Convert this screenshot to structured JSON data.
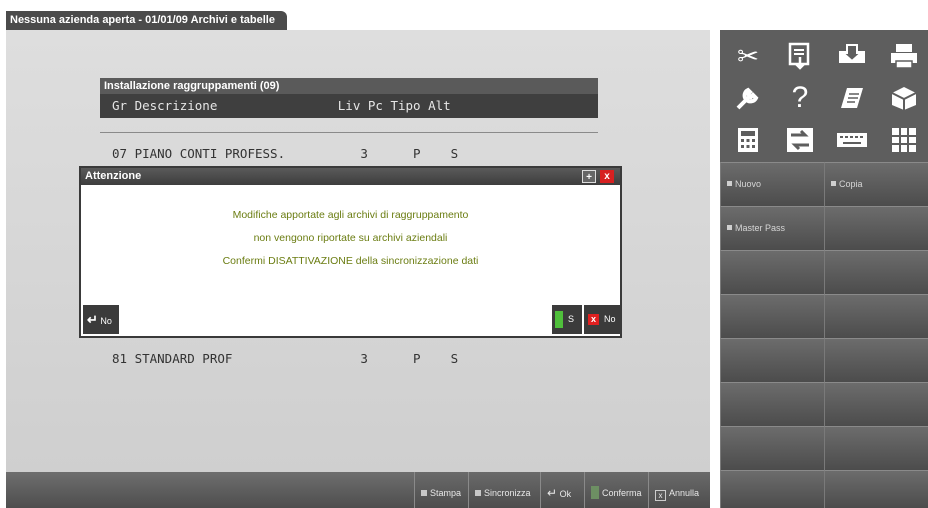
{
  "window": {
    "title": "Nessuna azienda aperta - 01/01/09  Archivi e tabelle"
  },
  "table": {
    "caption": "Installazione raggruppamenti (09)",
    "header": "Gr Descrizione                Liv Pc Tipo Alt",
    "rows": [
      "07 PIANO CONTI PROFESS.          3      P    S",
      "81 STANDARD PROF                 3      P    S"
    ]
  },
  "dialog": {
    "title": "Attenzione",
    "messages": [
      "Modifiche apportate agli archivi di raggruppamento",
      "non vengono riportate su archivi aziendali",
      "Confermi DISATTIVAZIONE della sincronizzazione dati"
    ],
    "left_button": "No",
    "yes_button": "S",
    "no_button": "No"
  },
  "bottom_bar": {
    "stampa": "Stampa",
    "sincronizza": "Sincronizza",
    "ok": "Ok",
    "conferma": "Conferma",
    "annulla": "Annulla"
  },
  "sidebar": {
    "icons": [
      "scissors-icon",
      "paste-icon",
      "print-preview-icon",
      "printer-icon",
      "wrench-icon",
      "help-icon",
      "notepad-icon",
      "box-icon",
      "calculator-icon",
      "transfer-icon",
      "keyboard-icon",
      "grid-icon"
    ],
    "buttons": [
      "Nuovo",
      "Copia",
      "Master Pass"
    ]
  }
}
